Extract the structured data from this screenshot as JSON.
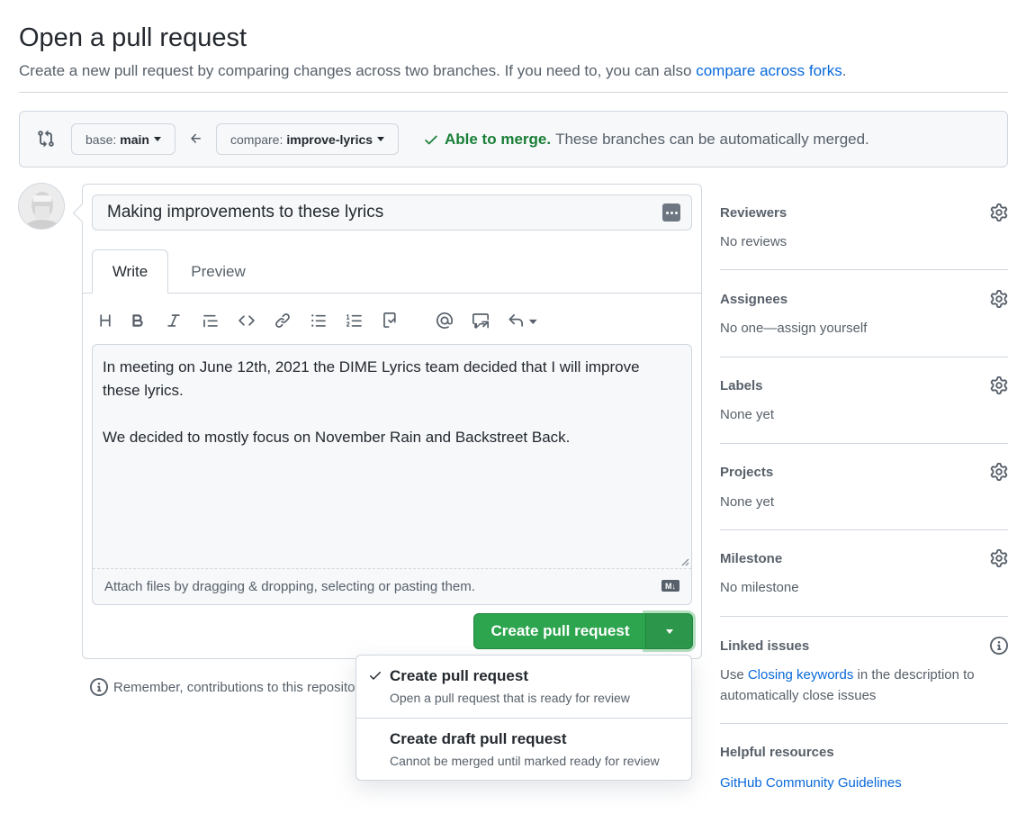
{
  "header": {
    "title": "Open a pull request",
    "subtitle_text": "Create a new pull request by comparing changes across two branches. If you need to, you can also ",
    "subtitle_link": "compare across forks",
    "subtitle_end": "."
  },
  "range": {
    "base_prefix": "base:",
    "base_branch": "main",
    "compare_prefix": "compare:",
    "compare_branch": "improve-lyrics",
    "merge_ok": "Able to merge.",
    "merge_text": "These branches can be automatically merged."
  },
  "form": {
    "title_value": "Making improvements to these lyrics",
    "tabs": [
      {
        "label": "Write",
        "active": true
      },
      {
        "label": "Preview",
        "active": false
      }
    ],
    "toolbar_icons": [
      "heading-icon",
      "bold-icon",
      "italic-icon",
      "quote-icon",
      "code-icon",
      "link-icon",
      "unordered-list-icon",
      "ordered-list-icon",
      "task-list-icon",
      "mention-icon",
      "reference-icon",
      "reply-icon"
    ],
    "body_lines": [
      "In meeting on June 12th, 2021 the DIME Lyrics team decided that I will improve these lyrics.",
      "We decided to mostly focus on November Rain and Backstreet Back."
    ],
    "attach_text": "Attach files by dragging & dropping, selecting or pasting them.",
    "markdown_badge": "M↓",
    "create_label": "Create pull request"
  },
  "remember_text": "Remember, contributions to this repository",
  "dropdown": {
    "items": [
      {
        "title": "Create pull request",
        "description": "Open a pull request that is ready for review",
        "selected": true
      },
      {
        "title": "Create draft pull request",
        "description": "Cannot be merged until marked ready for review",
        "selected": false
      }
    ]
  },
  "sidebar": {
    "reviewers": {
      "heading": "Reviewers",
      "value": "No reviews"
    },
    "assignees": {
      "heading": "Assignees",
      "value": "No one—assign yourself"
    },
    "labels": {
      "heading": "Labels",
      "value": "None yet"
    },
    "projects": {
      "heading": "Projects",
      "value": "None yet"
    },
    "milestone": {
      "heading": "Milestone",
      "value": "No milestone"
    },
    "linked_issues": {
      "heading": "Linked issues",
      "value_prefix": "Use ",
      "value_link": "Closing keywords",
      "value_suffix": " in the description to automatically close issues"
    },
    "helpful": {
      "heading": "Helpful resources",
      "link": "GitHub Community Guidelines"
    }
  },
  "colors": {
    "accent_link": "#0969da",
    "success": "#1a7f37",
    "primary_button": "#2da44e",
    "border": "#d0d7de"
  }
}
